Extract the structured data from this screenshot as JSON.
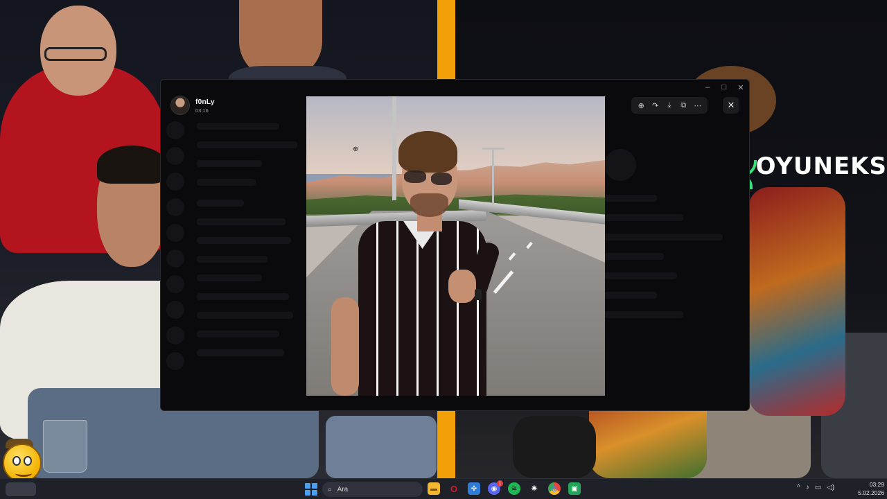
{
  "window": {
    "title": "",
    "controls": {
      "minimize": "–",
      "maximize": "□",
      "close": "✕"
    }
  },
  "viewer": {
    "uploader_name": "f0nLy",
    "uploader_time": "03:16",
    "toolbar": [
      {
        "name": "zoom-in-icon",
        "glyph": "⊕"
      },
      {
        "name": "rotate-icon",
        "glyph": "↷"
      },
      {
        "name": "download-icon",
        "glyph": "⤓"
      },
      {
        "name": "open-external-icon",
        "glyph": "⧉"
      },
      {
        "name": "more-icon",
        "glyph": "⋯"
      }
    ],
    "close_glyph": "✕"
  },
  "watermark": {
    "text": "OYUNEKS",
    "color": "#39e07a"
  },
  "taskbar": {
    "search_placeholder": "Ara",
    "search_glyph": "⌕",
    "apps": [
      {
        "name": "file-explorer-icon",
        "color": "#f2b630",
        "glyph": "▬"
      },
      {
        "name": "opera-icon",
        "color": "#d11a2a",
        "glyph": "O"
      },
      {
        "name": "network-app-icon",
        "color": "#2f7bd6",
        "glyph": "✣"
      },
      {
        "name": "discord-icon",
        "color": "#5865f2",
        "glyph": "◉",
        "badge": "1"
      },
      {
        "name": "spotify-icon",
        "color": "#1db954",
        "glyph": "≋"
      },
      {
        "name": "steam-settings-icon",
        "color": "#2f323b",
        "glyph": "✷"
      },
      {
        "name": "chrome-icon",
        "color": "#e8453c",
        "glyph": "◍"
      },
      {
        "name": "green-app-icon",
        "color": "#23a55a",
        "glyph": "▣"
      }
    ],
    "tray": [
      {
        "name": "chevron-up-icon",
        "glyph": "^"
      },
      {
        "name": "microphone-icon",
        "glyph": "♪"
      },
      {
        "name": "display-icon",
        "glyph": "▭"
      },
      {
        "name": "speaker-icon",
        "glyph": "◁)"
      }
    ],
    "time": "03:29",
    "date": "5.02.2026"
  }
}
